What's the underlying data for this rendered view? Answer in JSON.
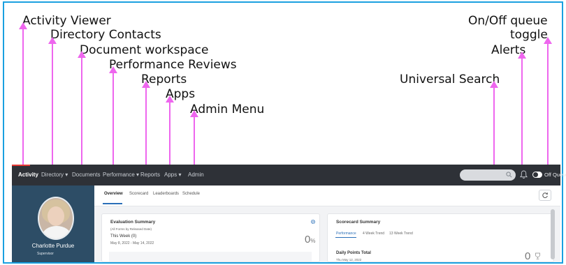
{
  "annotations": {
    "activity_viewer": "Activity Viewer",
    "directory_contacts": "Directory Contacts",
    "document_workspace": "Document workspace",
    "performance_reviews": "Performance Reviews",
    "reports": "Reports",
    "apps": "Apps",
    "admin_menu": "Admin Menu",
    "universal_search": "Universal Search",
    "alerts": "Alerts",
    "queue_toggle_line1": "On/Off queue",
    "queue_toggle_line2": "toggle"
  },
  "navbar": {
    "items": [
      {
        "label": "Activity",
        "active": true
      },
      {
        "label": "Directory ▾"
      },
      {
        "label": "Documents"
      },
      {
        "label": "Performance ▾"
      },
      {
        "label": "Reports"
      },
      {
        "label": "Apps ▾"
      },
      {
        "label": "Admin"
      }
    ],
    "queue_toggle_label": "Off Queue",
    "icons": {
      "search": "search-icon",
      "alerts": "bell-icon"
    },
    "colors": {
      "bar": "#2e3137",
      "active_indicator": "#e53935"
    }
  },
  "profile": {
    "name": "Charlotte Purdue",
    "role": "Supervisor"
  },
  "tabs": [
    "Overview",
    "Scorecard",
    "Leaderboards",
    "Schedule"
  ],
  "evaluation_summary": {
    "title": "Evaluation Summary",
    "subtitle": "(All Forms by Released Date)",
    "week_label": "This Week (0)",
    "date_range": "May 8, 2022 - May 14, 2022",
    "value": "0",
    "unit": "%"
  },
  "scorecard_summary": {
    "title": "Scorecard Summary",
    "subtabs": [
      "Performance",
      "4 Week Trend",
      "13 Week Trend"
    ],
    "metric_title": "Daily Points Total",
    "metric_date": "Thu May 12, 2022",
    "value": "0"
  },
  "colors": {
    "accent": "#2a6fb8",
    "annotation_arrow": "#ee66ee",
    "frame": "#1aa0e0",
    "sidebar": "#2d4d66"
  }
}
